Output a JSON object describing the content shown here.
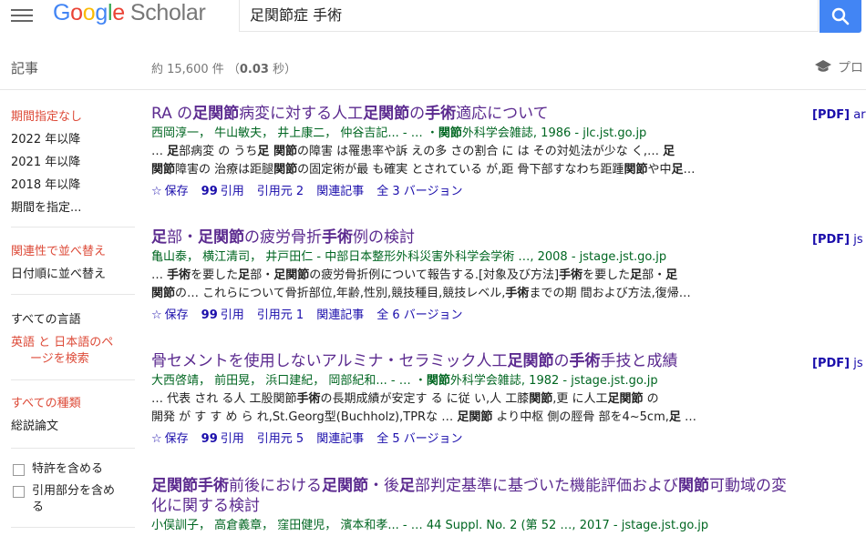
{
  "header": {
    "logo_google": [
      "G",
      "o",
      "o",
      "g",
      "l",
      "e"
    ],
    "logo_scholar": "Scholar",
    "search_value": "足関節症 手術"
  },
  "toolbar": {
    "section_label": "記事",
    "count_prefix": "約 15,600 件 （",
    "count_time": "0.03",
    "count_suffix": " 秒）",
    "profile_label": "プロ"
  },
  "sidebar": {
    "time": [
      "期間指定なし",
      "2022 年以降",
      "2021 年以降",
      "2018 年以降",
      "期間を指定..."
    ],
    "sort": [
      "関連性で並べ替え",
      "日付順に並べ替え"
    ],
    "lang": [
      "すべての言語",
      "英語 と 日本語のペ",
      "ージを検索"
    ],
    "type": [
      "すべての種類",
      "総説論文"
    ],
    "checks": [
      "特許を含める",
      "引用部分を含め",
      "る"
    ]
  },
  "results": [
    {
      "title": [
        [
          "RA の",
          false
        ],
        [
          "足関節",
          true
        ],
        [
          "病変に対する人工",
          false
        ],
        [
          "足関節",
          true
        ],
        [
          "の",
          false
        ],
        [
          "手術",
          true
        ],
        [
          "適応について",
          false
        ]
      ],
      "meta": [
        [
          "西岡淳一， 牛山敏夫， 井上康二， 仲谷吉記... - … ・",
          false
        ],
        [
          "関節",
          true
        ],
        [
          "外科学会雑誌, 1986 - jlc.jst.go.jp",
          false
        ]
      ],
      "snip1": [
        [
          "… ",
          false
        ],
        [
          "足",
          true
        ],
        [
          "部病変 の うち",
          false
        ],
        [
          "足 関節",
          true
        ],
        [
          "の障害 は罹患率や訴 えの多 さの割合 に は その対処法が少な く,… ",
          false
        ],
        [
          "足",
          true
        ]
      ],
      "snip2": [
        [
          "関節",
          true
        ],
        [
          "障害の 治療は距腿",
          false
        ],
        [
          "関節",
          true
        ],
        [
          "の固定術が最 も確実 とされている が,距 骨下部すなわち距踵",
          false
        ],
        [
          "関節",
          true
        ],
        [
          "や中",
          false
        ],
        [
          "足",
          true
        ],
        [
          "…",
          false
        ]
      ],
      "cited": "引用元 2",
      "versions": "全 3 バージョン",
      "pdf": "[PDF]",
      "pdf_src": "ar"
    },
    {
      "title": [
        [
          "足",
          true
        ],
        [
          "部・",
          false
        ],
        [
          "足関節",
          true
        ],
        [
          "の疲労骨折",
          false
        ],
        [
          "手術",
          true
        ],
        [
          "例の検討",
          false
        ]
      ],
      "meta": [
        [
          "亀山泰， 横江清司， 井戸田仁 - 中部日本整形外科災害外科学会学術 …, 2008 - jstage.jst.go.jp",
          false
        ]
      ],
      "snip1": [
        [
          "… ",
          false
        ],
        [
          "手術",
          true
        ],
        [
          "を要した",
          false
        ],
        [
          "足",
          true
        ],
        [
          "部・",
          false
        ],
        [
          "足関節",
          true
        ],
        [
          "の疲労骨折例について報告する.[対象及び方法]",
          false
        ],
        [
          "手術",
          true
        ],
        [
          "を要した",
          false
        ],
        [
          "足",
          true
        ],
        [
          "部・",
          false
        ],
        [
          "足",
          true
        ]
      ],
      "snip2": [
        [
          "関節",
          true
        ],
        [
          "の… これらについて骨折部位,年齢,性別,競技種目,競技レベル,",
          false
        ],
        [
          "手術",
          true
        ],
        [
          "までの期 間および方法,復帰…",
          false
        ]
      ],
      "cited": "引用元 1",
      "versions": "全 6 バージョン",
      "pdf": "[PDF]",
      "pdf_src": "js"
    },
    {
      "title": [
        [
          "骨セメントを使用しないアルミナ・セラミック人工",
          false
        ],
        [
          "足関節",
          true
        ],
        [
          "の",
          false
        ],
        [
          "手術",
          true
        ],
        [
          "手技と成績",
          false
        ]
      ],
      "meta": [
        [
          "大西啓靖， 前田晃， 浜口建紀， 岡部紀和... - … ・",
          false
        ],
        [
          "関節",
          true
        ],
        [
          "外科学会雑誌, 1982 - jstage.jst.go.jp",
          false
        ]
      ],
      "snip1": [
        [
          "… 代表 され る人 工股関節",
          false
        ],
        [
          "手術",
          true
        ],
        [
          "の長期成績が安定す る に従 い,人 工膝",
          false
        ],
        [
          "関節",
          true
        ],
        [
          ",更 に人工",
          false
        ],
        [
          "足関節",
          true
        ],
        [
          " の",
          false
        ]
      ],
      "snip2": [
        [
          "開発 が す す め ら れ,St.Georg型(Buchholz),TPRな … ",
          false
        ],
        [
          "足関節",
          true
        ],
        [
          " より中枢 側の脛骨 部を4~5cm,",
          false
        ],
        [
          "足",
          true
        ],
        [
          " …",
          false
        ]
      ],
      "cited": "引用元 5",
      "versions": "全 5 バージョン",
      "pdf": "[PDF]",
      "pdf_src": "js"
    },
    {
      "title": [
        [
          "足関節手術",
          true
        ],
        [
          "前後における",
          false
        ],
        [
          "足関節",
          true
        ],
        [
          "・後",
          false
        ],
        [
          "足",
          true
        ],
        [
          "部判定基準に基づいた機能評価および",
          false
        ],
        [
          "関節",
          true
        ],
        [
          "可動域の変化に関する検討",
          false
        ]
      ],
      "meta": [
        [
          "小俣訓子， 高倉義章， 窪田健児， 濱本和孝... - … 44 Suppl. No. 2 (第 52 …, 2017 - jstage.jst.go.jp",
          false
        ]
      ],
      "snip1": [],
      "snip2": [],
      "cited": "",
      "versions": "",
      "pdf": "",
      "pdf_src": ""
    }
  ],
  "actions": {
    "save": "保存",
    "cite": "引用",
    "related": "関連記事"
  }
}
